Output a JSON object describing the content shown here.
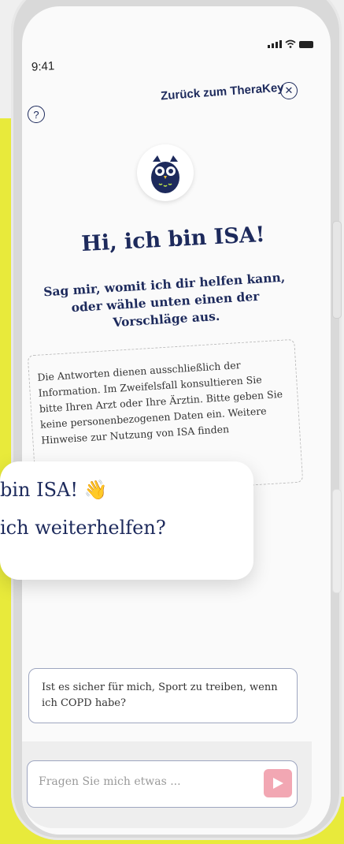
{
  "status": {
    "time": "9:41"
  },
  "header": {
    "help_label": "?",
    "back_label": "Zurück zum TheraKey",
    "close_label": "✕"
  },
  "hero": {
    "title": "Hi, ich bin ISA!",
    "subtitle": "Sag mir, womit ich dir helfen kann, oder wähle unten einen der Vorschläge aus."
  },
  "disclaimer": {
    "text": "Die Antworten dienen ausschließlich der Information. Im Zweifelsfall konsultieren Sie bitte Ihren Arzt oder Ihre Ärztin. Bitte geben Sie keine personenbezogenen Daten ein. Weitere Hinweise zur Nutzung von ISA finden"
  },
  "chat_bubble": {
    "line1": "bin ISA! 👋",
    "line2": "ich weiterhelfen?"
  },
  "suggestion": {
    "text": "Ist es sicher für mich, Sport zu treiben, wenn ich COPD habe?"
  },
  "input": {
    "placeholder": "Fragen Sie mich etwas ..."
  },
  "colors": {
    "accent_navy": "#1d2a5c",
    "yellow": "#e8ea3b",
    "send_pink": "#f2a7b3"
  },
  "icons": [
    "help-icon",
    "close-icon",
    "owl-avatar-icon",
    "send-icon",
    "signal-icon",
    "wifi-icon",
    "battery-icon"
  ]
}
